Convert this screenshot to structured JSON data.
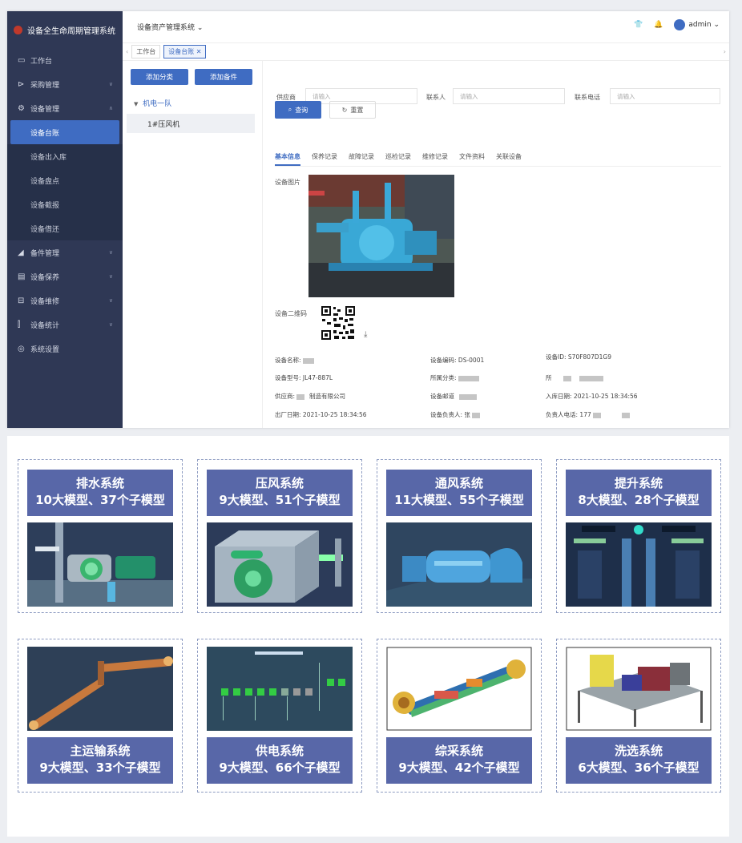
{
  "app": {
    "title": "设备全生命周期管理系统",
    "system": "设备资产管理系统",
    "user": "admin"
  },
  "sidebar": {
    "items": [
      {
        "label": "工作台",
        "icon": "monitor-icon"
      },
      {
        "label": "采购管理",
        "icon": "cart-icon"
      },
      {
        "label": "设备管理",
        "icon": "gear-icon"
      },
      {
        "label": "设备台账",
        "icon": ""
      },
      {
        "label": "设备出入库",
        "icon": ""
      },
      {
        "label": "设备盘点",
        "icon": ""
      },
      {
        "label": "设备截报",
        "icon": ""
      },
      {
        "label": "设备借还",
        "icon": ""
      },
      {
        "label": "备件管理",
        "icon": "parts-icon"
      },
      {
        "label": "设备保养",
        "icon": "maintenance-icon"
      },
      {
        "label": "设备维修",
        "icon": "repair-icon"
      },
      {
        "label": "设备统计",
        "icon": "chart-icon"
      },
      {
        "label": "系统设置",
        "icon": "settings-icon"
      }
    ]
  },
  "tabs": [
    "工作台",
    "设备台账"
  ],
  "tree": {
    "add_category": "添加分类",
    "add_device": "添加备件",
    "node": "机电一队",
    "child": "1#压风机"
  },
  "filters": {
    "supplier": "供应商",
    "contact": "联系人",
    "phone": "联系电话",
    "placeholder": "请输入",
    "query": "查询",
    "reset": "重置"
  },
  "detail_tabs": [
    "基本信息",
    "保养记录",
    "故障记录",
    "巡检记录",
    "维修记录",
    "文件资料",
    "关联设备"
  ],
  "detail": {
    "photo_label": "设备图片",
    "qr_label": "设备二维码",
    "fields": [
      {
        "label": "设备名称:",
        "value": ""
      },
      {
        "label": "设备编码:",
        "value": "DS-0001"
      },
      {
        "label": "设备ID:",
        "value": "S70F807D1G9"
      },
      {
        "label": "设备型号:",
        "value": "JL47-887L"
      },
      {
        "label": "所属分类:",
        "value": ""
      },
      {
        "label": "所",
        "value": ""
      },
      {
        "label": "供应商:",
        "value": "制造有限公司"
      },
      {
        "label": "设备邮道",
        "value": ""
      },
      {
        "label": "入库日期:",
        "value": "2021-10-25 18:34:56"
      },
      {
        "label": "出厂日期:",
        "value": "2021-10-25 18:34:56"
      },
      {
        "label": "设备负责人:",
        "value": "张"
      },
      {
        "label": "负责人电话:",
        "value": "177"
      }
    ]
  },
  "systems": [
    {
      "name": "排水系统",
      "models": "10大模型、37个子模型"
    },
    {
      "name": "压风系统",
      "models": "9大模型、51个子模型"
    },
    {
      "name": "通风系统",
      "models": "11大模型、55个子模型"
    },
    {
      "name": "提升系统",
      "models": "8大模型、28个子模型"
    },
    {
      "name": "主运输系统",
      "models": "9大模型、33个子模型"
    },
    {
      "name": "供电系统",
      "models": "9大模型、66个子模型"
    },
    {
      "name": "综采系统",
      "models": "9大模型、42个子模型"
    },
    {
      "name": "洗选系统",
      "models": "6大模型、36个子模型"
    }
  ],
  "colors": {
    "sidebar": "#2f3855",
    "accent": "#3f6cc2",
    "card_header": "#5867a8"
  }
}
